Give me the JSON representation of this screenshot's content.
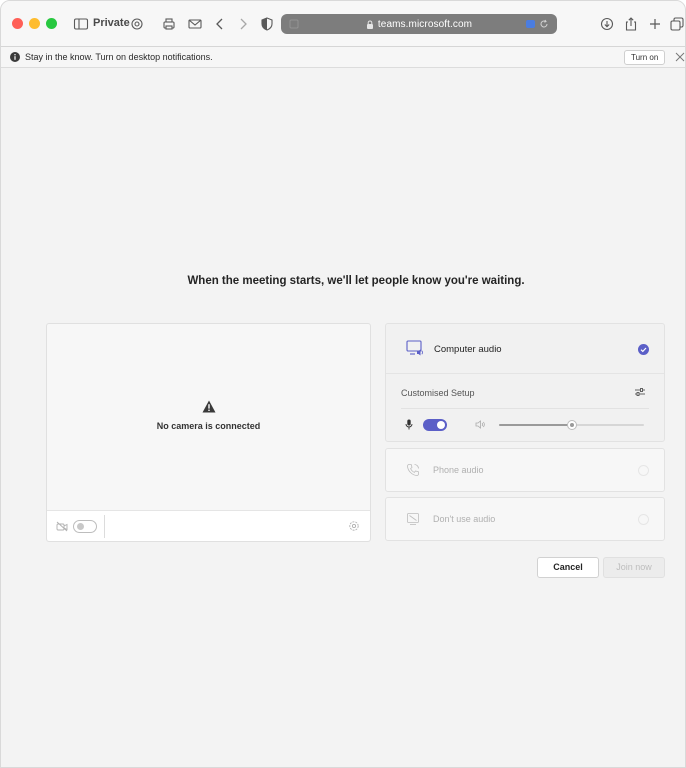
{
  "browser": {
    "private_label": "Private",
    "url": "teams.microsoft.com",
    "toolbar_icons": [
      "sidebar-icon",
      "privacy-settings-icon",
      "printer-icon",
      "mail-icon",
      "back-chevron-icon",
      "forward-chevron-icon",
      "shield-icon",
      "download-icon",
      "share-icon",
      "new-tab-plus-icon",
      "tab-overview-icon"
    ]
  },
  "notification": {
    "message": "Stay in the know. Turn on desktop notifications.",
    "turn_on_label": "Turn on"
  },
  "prejoin": {
    "headline": "When the meeting starts, we'll let people know you're waiting.",
    "camera": {
      "status_text": "No camera is connected",
      "camera_on": false
    },
    "audio": {
      "computer_audio_label": "Computer audio",
      "computer_audio_selected": true,
      "setup_label": "Customised Setup",
      "mic_on": true,
      "speaker_volume_fraction": 0.5,
      "phone_audio_label": "Phone audio",
      "no_audio_label": "Don't use audio"
    },
    "buttons": {
      "cancel_label": "Cancel",
      "join_label": "Join now",
      "join_enabled": false
    }
  },
  "colors": {
    "accent": "#5b5fc7",
    "background": "#f3f3f3"
  }
}
